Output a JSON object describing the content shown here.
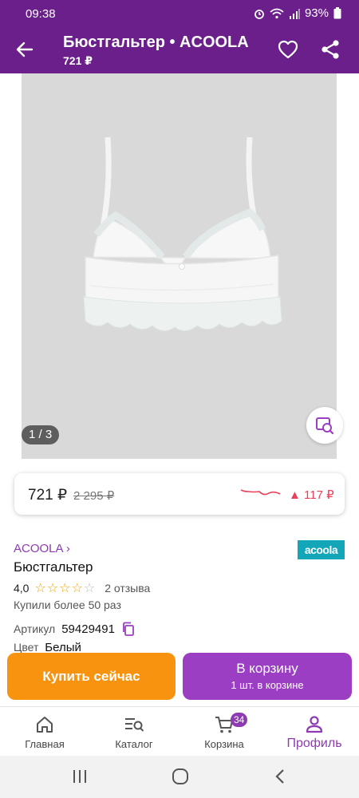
{
  "status": {
    "time": "09:38",
    "battery": "93%"
  },
  "header": {
    "title": "Бюстгальтер • ACOOLA",
    "price": "721 ₽"
  },
  "gallery": {
    "counter": "1 / 3"
  },
  "price_card": {
    "price": "721 ₽",
    "old_price": "2 295 ₽",
    "delta": "▲ 117 ₽"
  },
  "product": {
    "brand": "ACOOLA ›",
    "brand_logo": "acoola",
    "name": "Бюстгальтер",
    "rating": "4,0",
    "reviews": "2 отзыва",
    "bought": "Купили более 50 раз",
    "article_label": "Артикул",
    "article": "59429491",
    "color_label": "Цвет",
    "color": "Белый"
  },
  "actions": {
    "buy_now": "Купить сейчас",
    "to_cart": "В корзину",
    "cart_note": "1 шт. в корзине"
  },
  "nav": {
    "items": [
      {
        "label": "Главная",
        "icon": "home-icon"
      },
      {
        "label": "Каталог",
        "icon": "catalog-search-icon"
      },
      {
        "label": "Корзина",
        "icon": "cart-icon",
        "badge": "34"
      },
      {
        "label": "Профиль",
        "icon": "profile-icon",
        "active": true
      }
    ]
  },
  "colors": {
    "brand_purple": "#6a1f8a",
    "accent_purple": "#8e3bb3",
    "orange": "#f7930e",
    "cart_button": "#9b3ec4",
    "price_up": "#e8405a"
  }
}
